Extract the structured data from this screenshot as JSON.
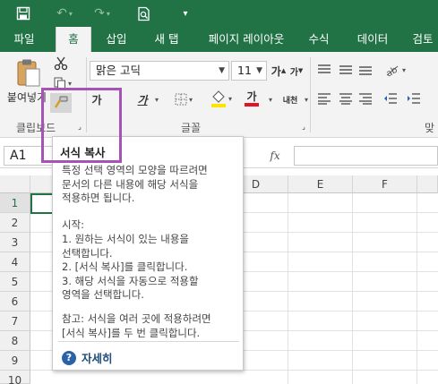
{
  "qat": {
    "save_icon": "save-icon",
    "undo_icon": "undo-icon",
    "redo_icon": "redo-icon",
    "preview_icon": "print-preview-icon",
    "customize_icon": "customize-qat-icon"
  },
  "tabs": [
    {
      "label": "파일",
      "active": false
    },
    {
      "label": "홈",
      "active": true
    },
    {
      "label": "삽입",
      "active": false
    },
    {
      "label": "새 탭",
      "active": false
    },
    {
      "label": "페이지 레이아웃",
      "active": false
    },
    {
      "label": "수식",
      "active": false
    },
    {
      "label": "데이터",
      "active": false
    },
    {
      "label": "검토",
      "active": false
    }
  ],
  "ribbon": {
    "paste_label": "붙여넣기",
    "clipboard_group": "클립보드",
    "font_group": "글꼴",
    "alignment_partial": "맞",
    "font_name": "맑은 고딕",
    "font_size": "11",
    "bold": "가",
    "italic": "가",
    "underline": "가",
    "grow_font": "가",
    "shrink_font": "가",
    "phonetic": "내천"
  },
  "formula_bar": {
    "name_box": "A1",
    "fx": "fx"
  },
  "grid": {
    "columns": [
      "D",
      "E",
      "F"
    ],
    "rows": [
      "1",
      "2",
      "3",
      "4",
      "5",
      "6",
      "7",
      "8",
      "9",
      "10"
    ]
  },
  "tooltip": {
    "title": "서식 복사",
    "desc": "특정 선택 영역의 모양을 따르려면\n문서의 다른 내용에 해당 서식을\n적용하면 됩니다.",
    "start_heading": "시작:",
    "steps": "1. 원하는 서식이 있는 내용을\n선택합니다.\n2. [서식 복사]를 클릭합니다.\n3. 해당 서식을 자동으로 적용할\n영역을 선택합니다.",
    "note": "참고: 서식을 여러 곳에 적용하려면\n[서식 복사]를 두 번 클릭합니다.",
    "help": "자세히"
  },
  "colors": {
    "accent": "#217346",
    "highlight": "#a553b5",
    "font_color": "#e81123",
    "fill_color": "#ffe400"
  }
}
